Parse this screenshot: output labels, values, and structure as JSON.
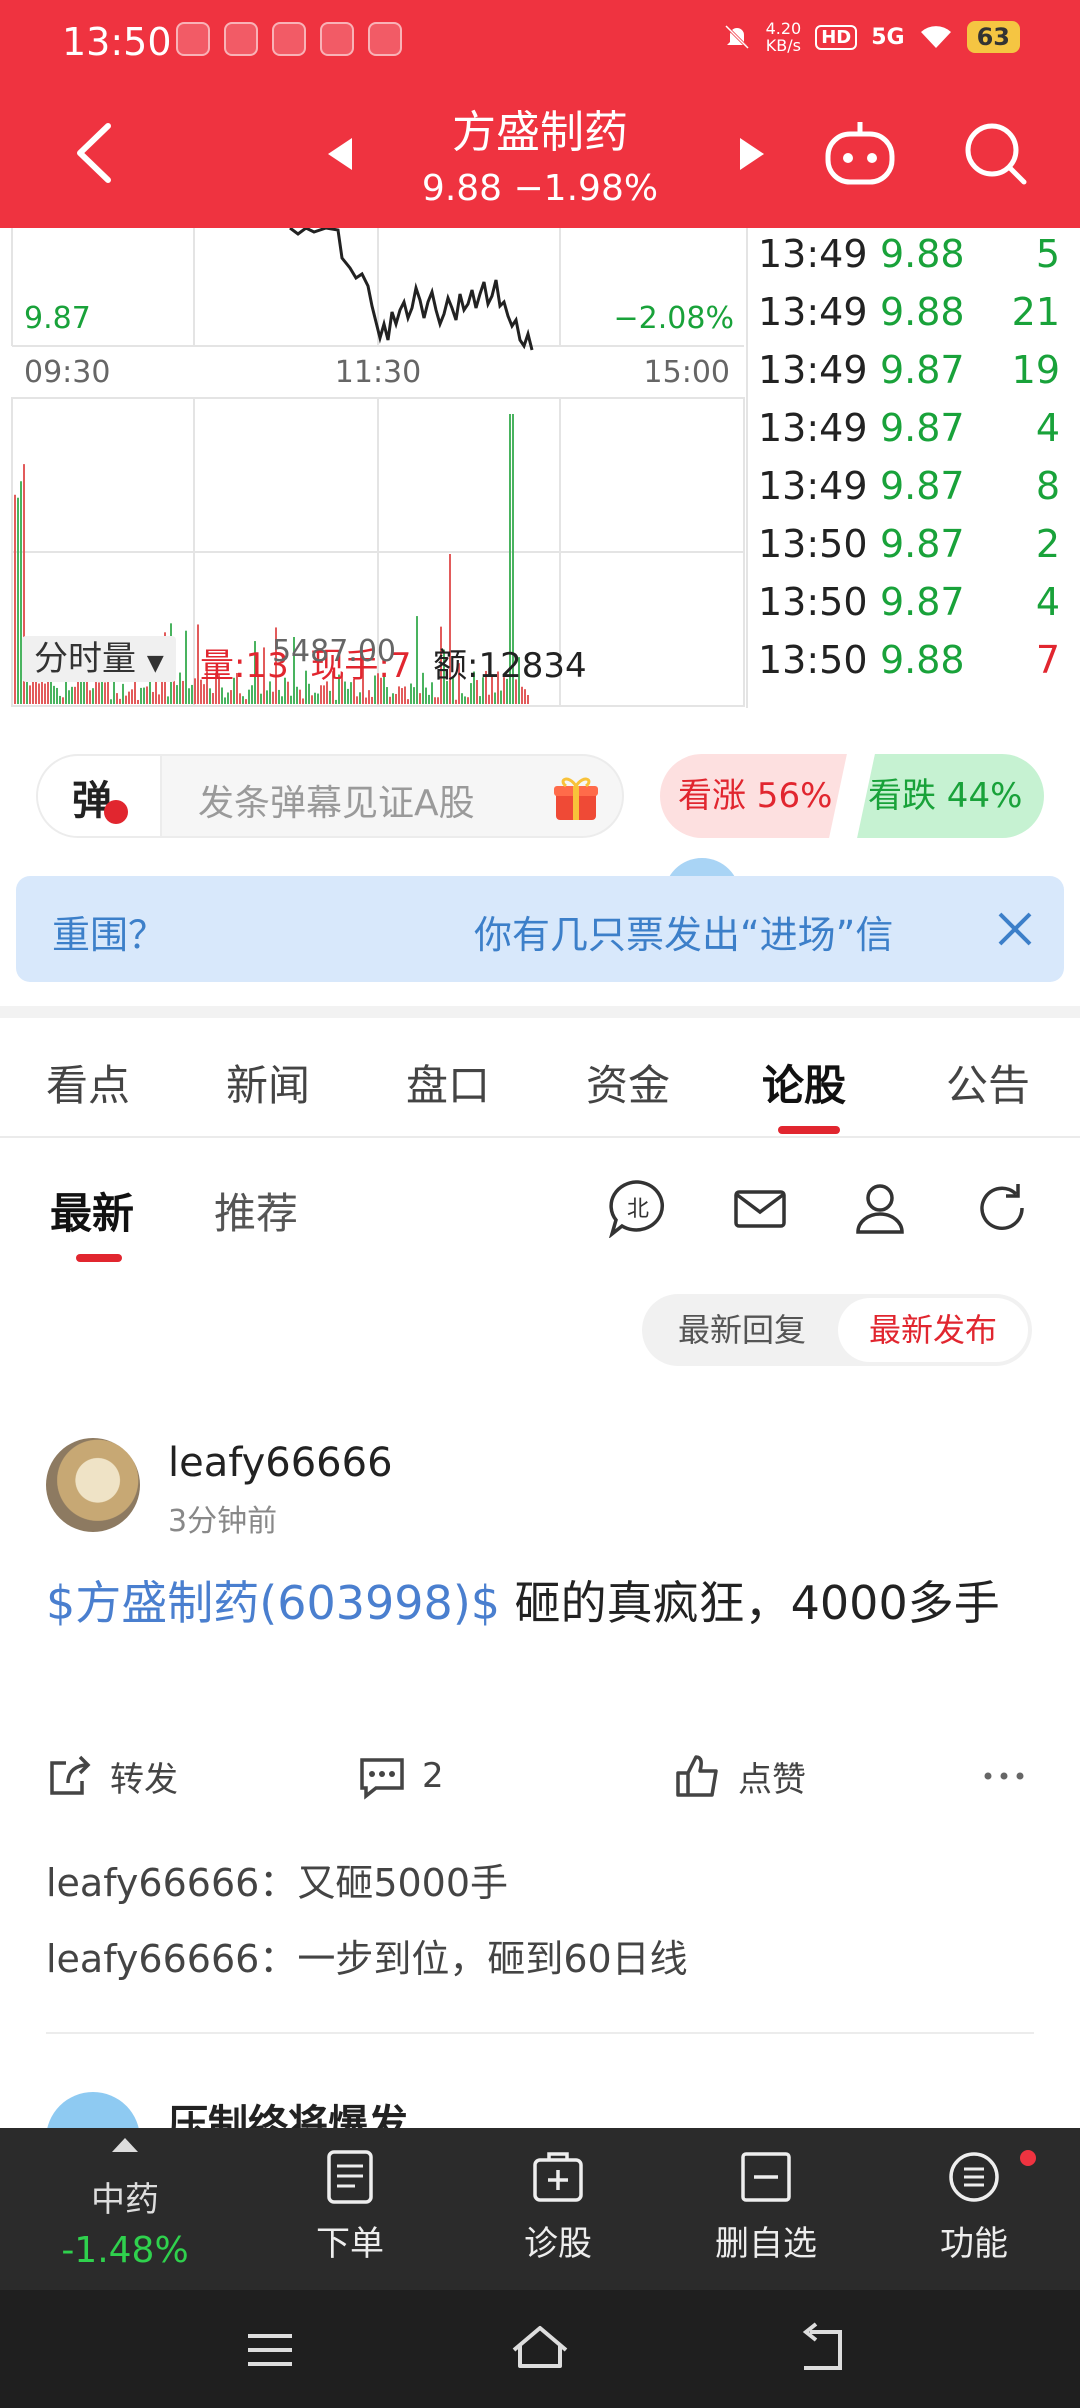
{
  "status_bar": {
    "time": "13:50",
    "net_speed": "4.20",
    "net_unit": "KB/s",
    "hd": "HD",
    "signal": "5G",
    "battery": "63"
  },
  "header": {
    "stock_name": "方盛制药",
    "stock_price": "9.88 −1.98%"
  },
  "chart": {
    "price_low": "9.87",
    "pct_low": "−2.08%",
    "time_axis": [
      "09:30",
      "11:30",
      "15:00"
    ],
    "vol_selector": "分时量",
    "vol_info": {
      "vol": "量:13",
      "hand": "现手:7",
      "amount": "额:12834"
    },
    "vol_max": "5487.00"
  },
  "trades": [
    {
      "time": "13:49",
      "price": "9.88",
      "vol": "5",
      "side": "sell"
    },
    {
      "time": "13:49",
      "price": "9.88",
      "vol": "21",
      "side": "sell"
    },
    {
      "time": "13:49",
      "price": "9.87",
      "vol": "19",
      "side": "sell"
    },
    {
      "time": "13:49",
      "price": "9.87",
      "vol": "4",
      "side": "sell"
    },
    {
      "time": "13:49",
      "price": "9.87",
      "vol": "8",
      "side": "sell"
    },
    {
      "time": "13:50",
      "price": "9.87",
      "vol": "2",
      "side": "sell"
    },
    {
      "time": "13:50",
      "price": "9.87",
      "vol": "4",
      "side": "sell"
    },
    {
      "time": "13:50",
      "price": "9.88",
      "vol": "7",
      "side": "buy"
    }
  ],
  "danmu": {
    "badge": "弹",
    "placeholder": "发条弹幕见证A股"
  },
  "vote": {
    "up": "看涨 56%",
    "down": "看跌 44%"
  },
  "banner": {
    "left_text": "重围？",
    "scroll_text": "你有几只票发出“进场”信"
  },
  "tabs": [
    "看点",
    "新闻",
    "盘口",
    "资金",
    "论股",
    "公告"
  ],
  "subtabs": [
    "最新",
    "推荐"
  ],
  "sort": [
    "最新回复",
    "最新发布"
  ],
  "post": {
    "user": "leafy66666",
    "time": "3分钟前",
    "stock_link": "$方盛制药(603998)$",
    "text": " 砸的真疯狂，4000多手",
    "repost": "转发",
    "comments": "2",
    "like": "点赞",
    "replies": [
      {
        "user": "leafy66666：",
        "text": "又砸5000手"
      },
      {
        "user": "leafy66666：",
        "text": "一步到位，砸到60日线"
      }
    ]
  },
  "next_post": {
    "user": "压制终将爆发"
  },
  "bottom_bar": {
    "market_name": "中药",
    "market_change": "-1.48%",
    "items": [
      "下单",
      "诊股",
      "删自选",
      "功能"
    ]
  },
  "colors": {
    "brand_red": "#ef3340",
    "up_red": "#e1262f",
    "down_green": "#19a23a",
    "link_blue": "#4a7fcf"
  }
}
